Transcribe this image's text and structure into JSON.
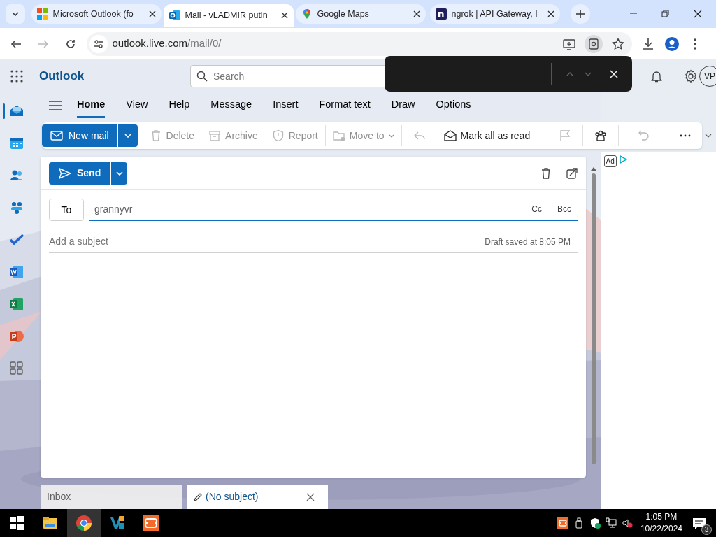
{
  "browser": {
    "tabs": [
      {
        "title": "Microsoft Outlook (fo",
        "selected": false
      },
      {
        "title": "Mail - vLADMIR putin",
        "selected": true
      },
      {
        "title": "Google Maps",
        "selected": false
      },
      {
        "title": "ngrok | API Gateway, I",
        "selected": false
      }
    ],
    "url": {
      "host": "outlook.live.com",
      "path": "/mail/0/"
    }
  },
  "outlook": {
    "app_name": "Outlook",
    "search": {
      "placeholder": "Search"
    },
    "avatar": "VP",
    "rail": [
      {
        "selected": true
      },
      {
        "selected": false
      },
      {
        "selected": false
      },
      {
        "selected": false
      },
      {
        "selected": false
      },
      {
        "selected": false
      },
      {
        "selected": false
      },
      {
        "selected": false
      },
      {
        "selected": false
      }
    ],
    "ribbon_tabs": [
      {
        "label": "Home",
        "selected": true
      },
      {
        "label": "View",
        "selected": false
      },
      {
        "label": "Help",
        "selected": false
      },
      {
        "label": "Message",
        "selected": false
      },
      {
        "label": "Insert",
        "selected": false
      },
      {
        "label": "Format text",
        "selected": false
      },
      {
        "label": "Draw",
        "selected": false
      },
      {
        "label": "Options",
        "selected": false
      }
    ],
    "toolbar": [
      {
        "kind": "primary",
        "label": "New mail",
        "disabled": false
      },
      {
        "kind": "button",
        "label": "Delete",
        "disabled": true
      },
      {
        "kind": "button",
        "label": "Archive",
        "disabled": true
      },
      {
        "kind": "button",
        "label": "Report",
        "disabled": true
      },
      {
        "kind": "menu",
        "label": "Move to",
        "disabled": true
      },
      {
        "kind": "icon",
        "disabled": true
      },
      {
        "kind": "button",
        "label": "Mark all as read",
        "disabled": false
      },
      {
        "kind": "icon",
        "disabled": true
      },
      {
        "kind": "icon",
        "disabled": false
      },
      {
        "kind": "icon",
        "disabled": true
      },
      {
        "kind": "icon",
        "disabled": false
      }
    ],
    "compose": {
      "send": "Send",
      "to_label": "To",
      "recipient": "grannyvr",
      "cc": "Cc",
      "bcc": "Bcc",
      "subject": {
        "placeholder": "Add a subject"
      },
      "draft_status": "Draft saved at 8:05 PM"
    },
    "ad_label": "Ad",
    "bottom_tabs": [
      {
        "label": "Inbox",
        "selected": false
      },
      {
        "label": "(No subject)",
        "selected": true
      }
    ]
  },
  "taskbar": {
    "time": "1:05 PM",
    "date": "10/22/2024",
    "notifications": "3"
  }
}
